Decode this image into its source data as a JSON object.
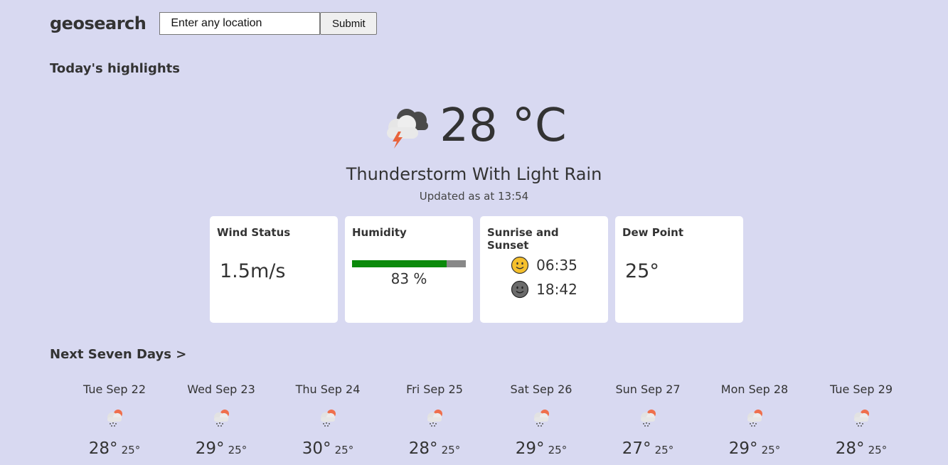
{
  "header": {
    "logo": "geosearch",
    "search_placeholder": "Enter any location",
    "submit_label": "Submit"
  },
  "highlights": {
    "title": "Today's highlights",
    "temperature": "28 °C",
    "description": "Thunderstorm With Light Rain",
    "updated": "Updated as at 13:54",
    "icon": "thunderstorm-cloud-icon"
  },
  "cards": {
    "wind": {
      "title": "Wind Status",
      "value": "1.5m/s"
    },
    "humidity": {
      "title": "Humidity",
      "value": "83 %",
      "fill_fraction": 0.83,
      "fill_color": "#0b8a0b",
      "track_color": "#888888"
    },
    "sun": {
      "title": "Sunrise and Sunset",
      "sunrise": "06:35",
      "sunset": "18:42",
      "sunrise_icon": "sun-face-icon",
      "sunset_icon": "moon-face-icon"
    },
    "dew": {
      "title": "Dew Point",
      "value": "25°"
    }
  },
  "forecast": {
    "title": "Next Seven Days >",
    "icon": "rain-cloud-icon",
    "days": [
      {
        "label": "Tue Sep 22",
        "high": "28°",
        "low": "25°"
      },
      {
        "label": "Wed Sep 23",
        "high": "29°",
        "low": "25°"
      },
      {
        "label": "Thu Sep 24",
        "high": "30°",
        "low": "25°"
      },
      {
        "label": "Fri Sep 25",
        "high": "28°",
        "low": "25°"
      },
      {
        "label": "Sat Sep 26",
        "high": "29°",
        "low": "25°"
      },
      {
        "label": "Sun Sep 27",
        "high": "27°",
        "low": "25°"
      },
      {
        "label": "Mon Sep 28",
        "high": "29°",
        "low": "25°"
      },
      {
        "label": "Tue Sep 29",
        "high": "28°",
        "low": "25°"
      }
    ]
  },
  "colors": {
    "background": "#d8d9f1",
    "card": "#ffffff",
    "text": "#333333"
  }
}
